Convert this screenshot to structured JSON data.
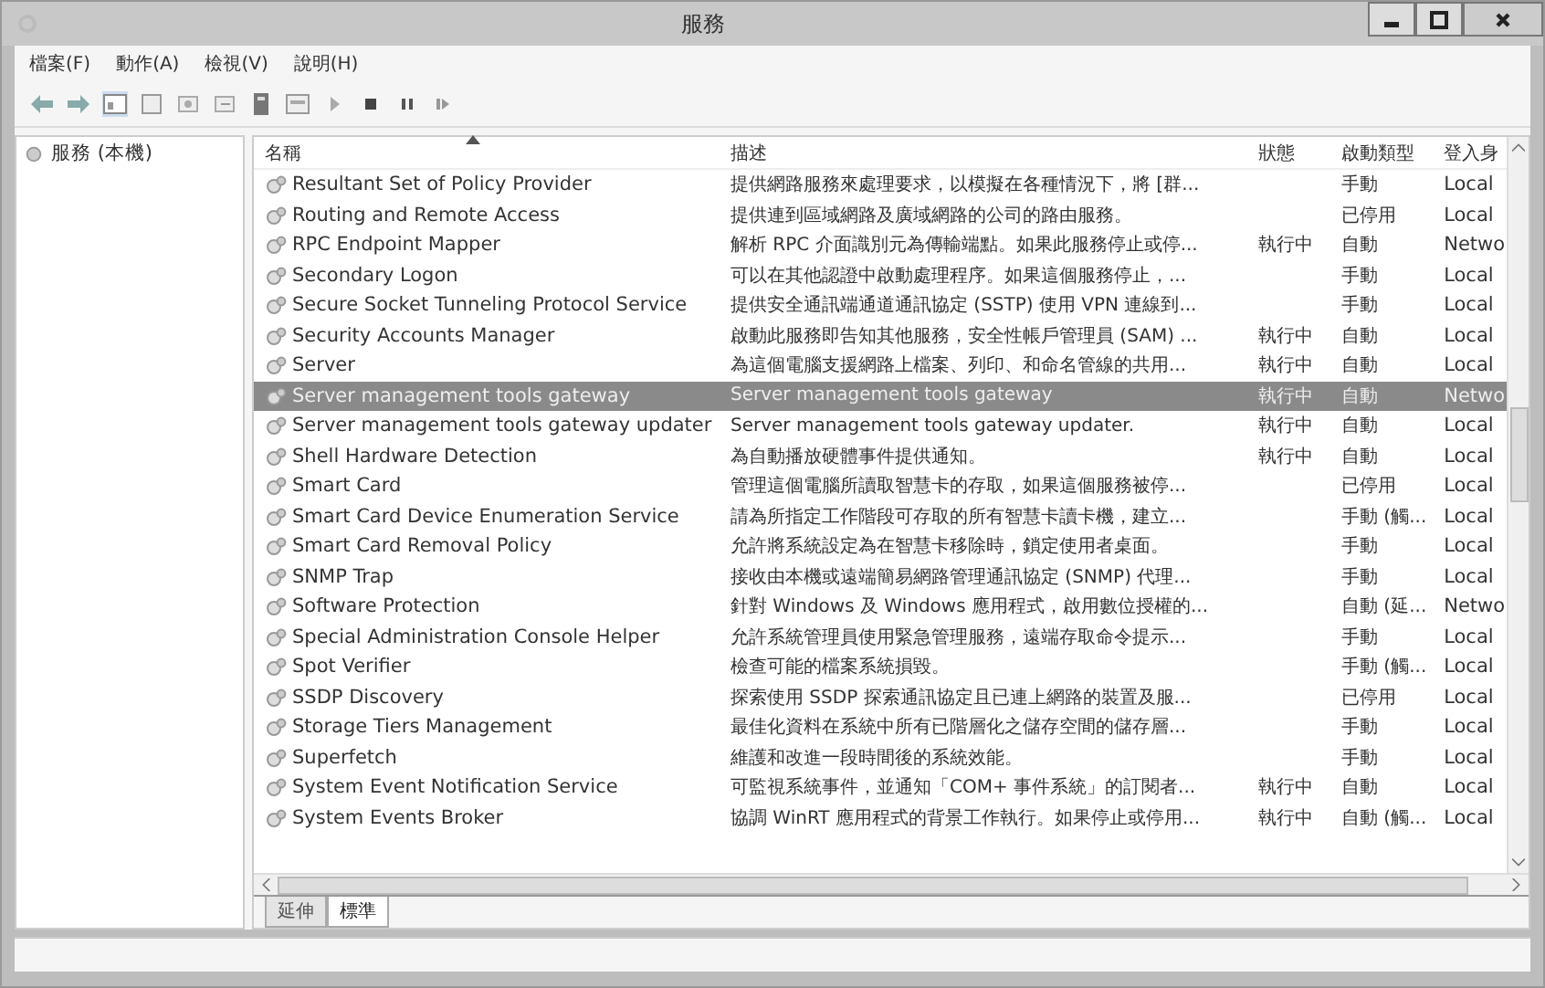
{
  "window": {
    "title": "服務"
  },
  "menu": [
    "檔案(F)",
    "動作(A)",
    "檢視(V)",
    "說明(H)"
  ],
  "tree": {
    "items": [
      {
        "label": "服務 (本機)",
        "selected": false
      }
    ]
  },
  "table": {
    "columns": [
      {
        "label": "名稱",
        "sorted": true
      },
      {
        "label": "描述",
        "sorted": false
      },
      {
        "label": "狀態",
        "sorted": false
      },
      {
        "label": "啟動類型",
        "sorted": false
      },
      {
        "label": "登入身",
        "sorted": false
      }
    ],
    "rows": [
      {
        "name": "Resultant Set of Policy Provider",
        "description": "提供網路服務來處理要求，以模擬在各種情況下，將 [群...",
        "status": "",
        "startup": "手動",
        "logon": "Local",
        "selected": false
      },
      {
        "name": "Routing and Remote Access",
        "description": "提供連到區域網路及廣域網路的公司的路由服務。",
        "status": "",
        "startup": "已停用",
        "logon": "Local",
        "selected": false
      },
      {
        "name": "RPC Endpoint Mapper",
        "description": "解析 RPC 介面識別元為傳輸端點。如果此服務停止或停...",
        "status": "執行中",
        "startup": "自動",
        "logon": "Netwo",
        "selected": false
      },
      {
        "name": "Secondary Logon",
        "description": "可以在其他認證中啟動處理程序。如果這個服務停止，...",
        "status": "",
        "startup": "手動",
        "logon": "Local",
        "selected": false
      },
      {
        "name": "Secure Socket Tunneling Protocol Service",
        "description": "提供安全通訊端通道通訊協定 (SSTP) 使用 VPN 連線到...",
        "status": "",
        "startup": "手動",
        "logon": "Local",
        "selected": false
      },
      {
        "name": "Security Accounts Manager",
        "description": "啟動此服務即告知其他服務，安全性帳戶管理員 (SAM) ...",
        "status": "執行中",
        "startup": "自動",
        "logon": "Local",
        "selected": false
      },
      {
        "name": "Server",
        "description": "為這個電腦支援網路上檔案、列印、和命名管線的共用...",
        "status": "執行中",
        "startup": "自動",
        "logon": "Local",
        "selected": false
      },
      {
        "name": "Server management tools gateway",
        "description": "Server management tools gateway",
        "status": "執行中",
        "startup": "自動",
        "logon": "Netwo",
        "selected": true
      },
      {
        "name": "Server management tools gateway updater",
        "description": "Server management tools gateway updater.",
        "status": "執行中",
        "startup": "自動",
        "logon": "Local",
        "selected": false
      },
      {
        "name": "Shell Hardware Detection",
        "description": "為自動播放硬體事件提供通知。",
        "status": "執行中",
        "startup": "自動",
        "logon": "Local",
        "selected": false
      },
      {
        "name": "Smart Card",
        "description": "管理這個電腦所讀取智慧卡的存取，如果這個服務被停...",
        "status": "",
        "startup": "已停用",
        "logon": "Local",
        "selected": false
      },
      {
        "name": "Smart Card Device Enumeration Service",
        "description": "請為所指定工作階段可存取的所有智慧卡讀卡機，建立...",
        "status": "",
        "startup": "手動 (觸...",
        "logon": "Local",
        "selected": false
      },
      {
        "name": "Smart Card Removal Policy",
        "description": "允許將系統設定為在智慧卡移除時，鎖定使用者桌面。",
        "status": "",
        "startup": "手動",
        "logon": "Local",
        "selected": false
      },
      {
        "name": "SNMP Trap",
        "description": "接收由本機或遠端簡易網路管理通訊協定 (SNMP) 代理...",
        "status": "",
        "startup": "手動",
        "logon": "Local",
        "selected": false
      },
      {
        "name": "Software Protection",
        "description": "針對 Windows 及 Windows 應用程式，啟用數位授權的...",
        "status": "",
        "startup": "自動 (延...",
        "logon": "Netwo",
        "selected": false
      },
      {
        "name": "Special Administration Console Helper",
        "description": "允許系統管理員使用緊急管理服務，遠端存取命令提示...",
        "status": "",
        "startup": "手動",
        "logon": "Local",
        "selected": false
      },
      {
        "name": "Spot Verifier",
        "description": "檢查可能的檔案系統損毀。",
        "status": "",
        "startup": "手動 (觸...",
        "logon": "Local",
        "selected": false
      },
      {
        "name": "SSDP Discovery",
        "description": "探索使用 SSDP 探索通訊協定且已連上網路的裝置及服...",
        "status": "",
        "startup": "已停用",
        "logon": "Local",
        "selected": false
      },
      {
        "name": "Storage Tiers Management",
        "description": "最佳化資料在系統中所有已階層化之儲存空間的儲存層...",
        "status": "",
        "startup": "手動",
        "logon": "Local",
        "selected": false
      },
      {
        "name": "Superfetch",
        "description": "維護和改進一段時間後的系統效能。",
        "status": "",
        "startup": "手動",
        "logon": "Local",
        "selected": false
      },
      {
        "name": "System Event Notification Service",
        "description": "可監視系統事件，並通知「COM+ 事件系統」的訂閱者...",
        "status": "執行中",
        "startup": "自動",
        "logon": "Local",
        "selected": false
      },
      {
        "name": "System Events Broker",
        "description": "協調 WinRT 應用程式的背景工作執行。如果停止或停用...",
        "status": "執行中",
        "startup": "自動 (觸...",
        "logon": "Local",
        "selected": false
      }
    ]
  },
  "tabs": [
    {
      "label": "延伸",
      "selected": false
    },
    {
      "label": "標準",
      "selected": true
    }
  ]
}
